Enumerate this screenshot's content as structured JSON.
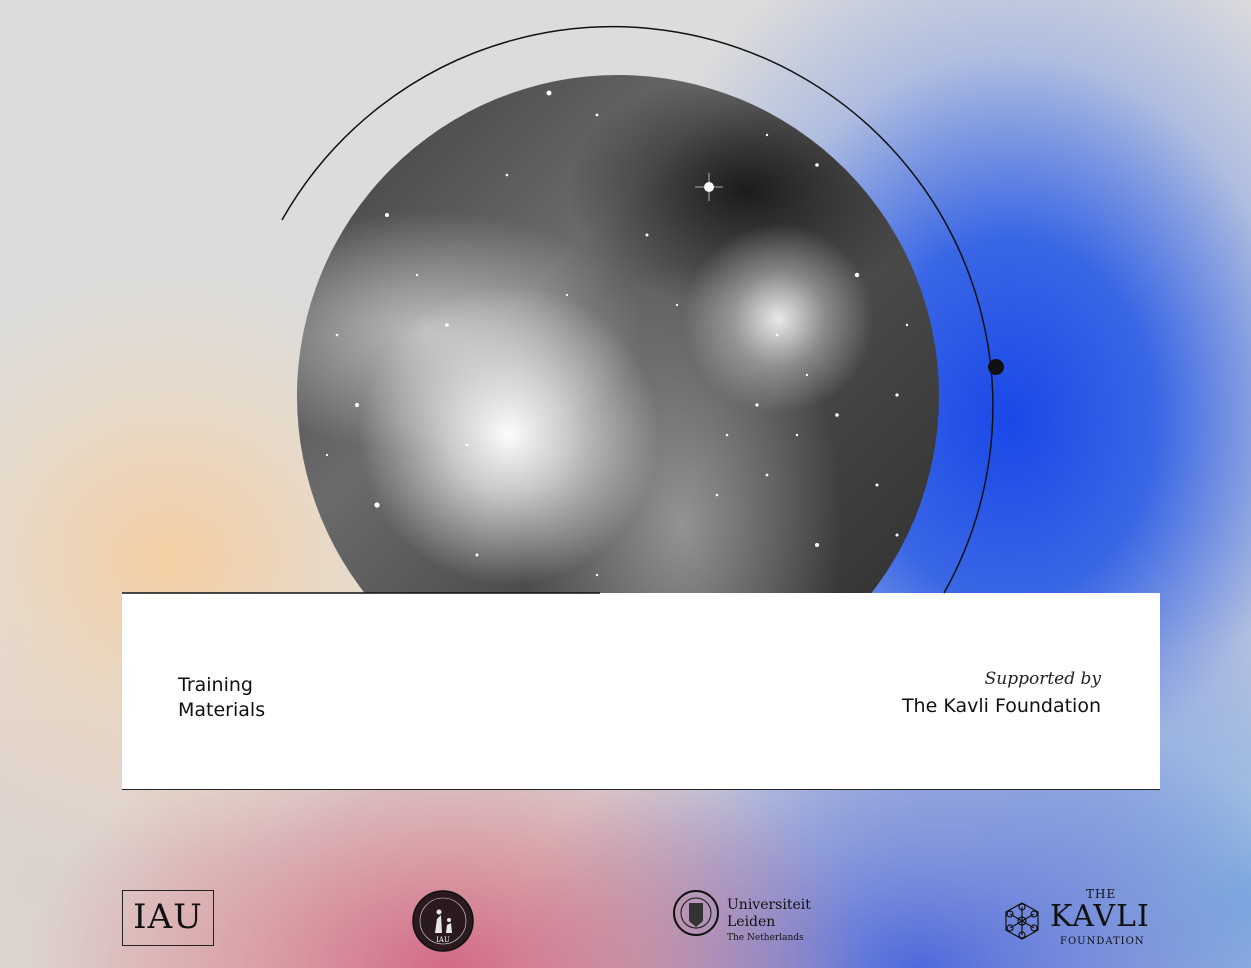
{
  "panel": {
    "left_text_line1": "Training",
    "left_text_line2": "Materials",
    "supported_by": "Supported by",
    "foundation": "The Kavli Foundation"
  },
  "logos": {
    "iau": "IAU",
    "oad_badge": "IAU",
    "leiden_line1": "Universiteit",
    "leiden_line2": "Leiden",
    "leiden_line3": "The Netherlands",
    "kavli_the": "THE",
    "kavli_name": "KAVLI",
    "kavli_foundation": "FOUNDATION"
  },
  "colors": {
    "accent_blue": "#1a48e8",
    "peach": "#f6cda0",
    "pink": "#d2647f"
  }
}
